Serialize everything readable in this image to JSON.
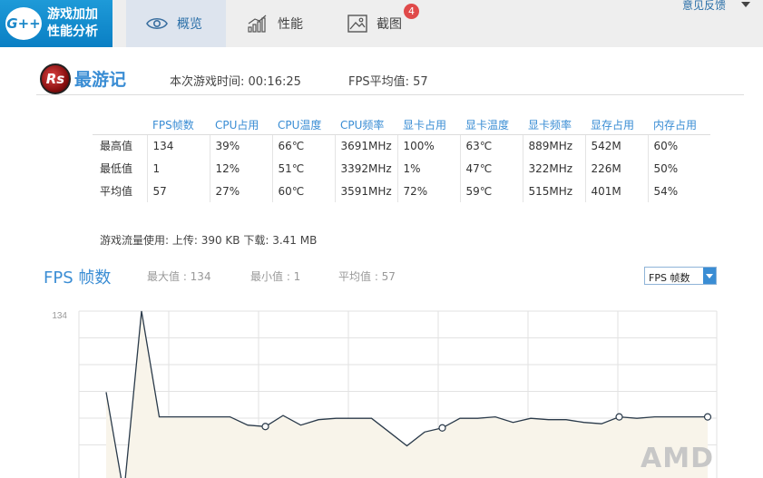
{
  "app": {
    "logo_badge": "G++",
    "logo_line1": "游戏加加",
    "logo_line2": "性能分析",
    "feedback": "意见反馈"
  },
  "tabs": [
    {
      "label": "概览",
      "icon": "eye-icon",
      "active": true
    },
    {
      "label": "性能",
      "icon": "bar-chart-icon",
      "active": false
    },
    {
      "label": "截图",
      "icon": "picture-icon",
      "active": false,
      "badge": "4"
    }
  ],
  "game": {
    "logo_text": "Rs",
    "name": "最游记",
    "play_time": "本次游戏时间: 00:16:25",
    "fps_avg": "FPS平均值: 57"
  },
  "stats": {
    "headers": [
      "FPS帧数",
      "CPU占用",
      "CPU温度",
      "CPU频率",
      "显卡占用",
      "显卡温度",
      "显卡频率",
      "显存占用",
      "内存占用"
    ],
    "rows": [
      {
        "label": "最高值",
        "values": [
          "134",
          "39%",
          "66℃",
          "3691MHz",
          "100%",
          "63℃",
          "889MHz",
          "542M",
          "60%"
        ]
      },
      {
        "label": "最低值",
        "values": [
          "1",
          "12%",
          "51℃",
          "3392MHz",
          "1%",
          "47℃",
          "322MHz",
          "226M",
          "50%"
        ]
      },
      {
        "label": "平均值",
        "values": [
          "57",
          "27%",
          "60℃",
          "3591MHz",
          "72%",
          "59℃",
          "515MHz",
          "401M",
          "54%"
        ]
      }
    ]
  },
  "traffic": "游戏流量使用: 上传: 390 KB   下载: 3.41 MB",
  "chart_header": {
    "title": "FPS 帧数",
    "max": "最大值 : 134",
    "min": "最小值 : 1",
    "avg": "平均值 : 57",
    "select_value": "FPS 帧数"
  },
  "chart_data": {
    "type": "line",
    "y_tick_label": "134",
    "ylim": [
      0,
      134
    ],
    "series": [
      {
        "values": [
          75,
          1,
          134,
          57,
          57,
          57,
          57,
          57,
          51,
          50,
          58,
          51,
          55,
          56,
          56,
          56,
          46,
          36,
          46,
          49,
          56,
          56,
          57,
          53,
          56,
          55,
          55,
          53,
          52,
          57,
          56,
          57,
          57,
          57,
          57
        ],
        "markers": [
          9,
          19,
          29,
          34
        ]
      }
    ],
    "grid": true,
    "fill_color": "#f8f4ea",
    "line_color": "#2a3a4a"
  },
  "watermark": "AMD"
}
